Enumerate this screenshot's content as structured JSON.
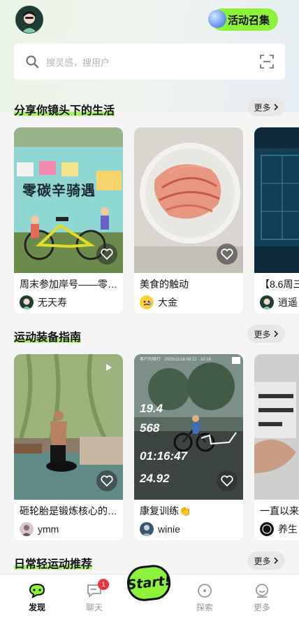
{
  "header": {
    "campaign_label": "活动召集",
    "search_placeholder": "搜灵感，搜用户"
  },
  "sections": [
    {
      "title": "分享你镜头下的生活",
      "more_label": "更多",
      "cards": [
        {
          "title": "周末参加岸号——零…",
          "user": "无天寿",
          "banner_text": "零碳辛骑遇"
        },
        {
          "title": "美食的触动",
          "user": "大金"
        },
        {
          "title": "【8.6周三",
          "user": "逍遥"
        }
      ]
    },
    {
      "title": "运动装备指南",
      "more_label": "更多",
      "cards": [
        {
          "title": "砸轮胎是锻炼核心的…",
          "user": "ymm"
        },
        {
          "title": "康复训练👏",
          "user": "winie",
          "overlay": {
            "top": "客户的骑行 · 2025/11/16 08:22 · 10:18",
            "distance": "19.4",
            "calories": "568",
            "duration": "01:16:47",
            "speed": "24.92"
          }
        },
        {
          "title": "一直以来",
          "user": "养生"
        }
      ]
    },
    {
      "title": "日常轻运动推荐",
      "more_label": "更多"
    }
  ],
  "tabbar": {
    "tabs": [
      {
        "label": "发现"
      },
      {
        "label": "聊天",
        "badge": "1"
      },
      {
        "label": "探索"
      },
      {
        "label": "更多"
      }
    ],
    "start_label": "Start!"
  }
}
